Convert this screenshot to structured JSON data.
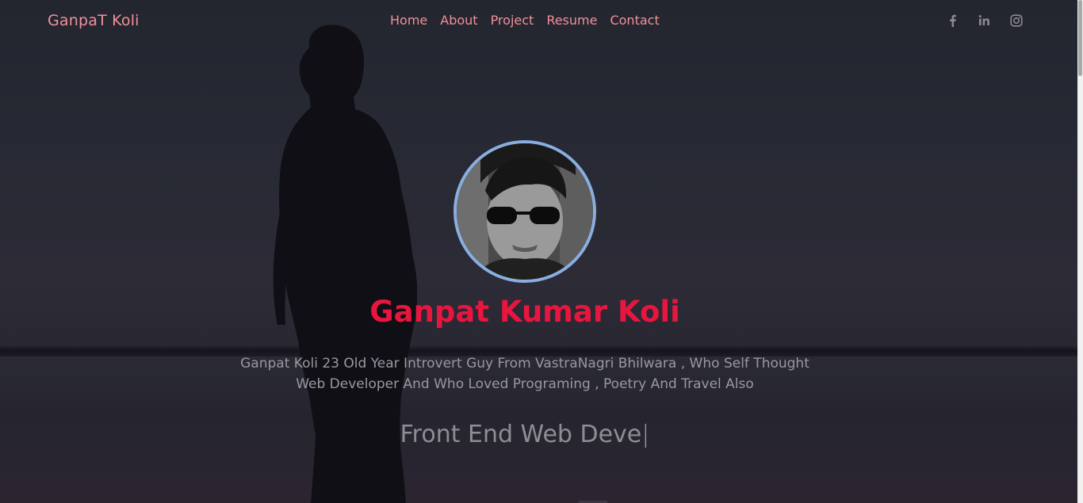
{
  "brand": "GanpaT Koli",
  "nav": {
    "links": [
      "Home",
      "About",
      "Project",
      "Resume",
      "Contact"
    ]
  },
  "socials": [
    "facebook-icon",
    "linkedin-icon",
    "instagram-icon"
  ],
  "profile": {
    "name": "Ganpat Kumar Koli",
    "bio_line1": "Ganpat Koli 23 Old Year Introvert Guy From VastraNagri Bhilwara , Who Self Thought",
    "bio_line2": "Web Developer And Who Loved Programing , Poetry And Travel Also",
    "typed_text": "Front End Web Deve",
    "typed_cursor": "|"
  },
  "colors": {
    "accent": "#e8163f",
    "nav_link": "#f1929a",
    "avatar_ring": "#8aaee0",
    "text_muted": "#9a98a0"
  }
}
